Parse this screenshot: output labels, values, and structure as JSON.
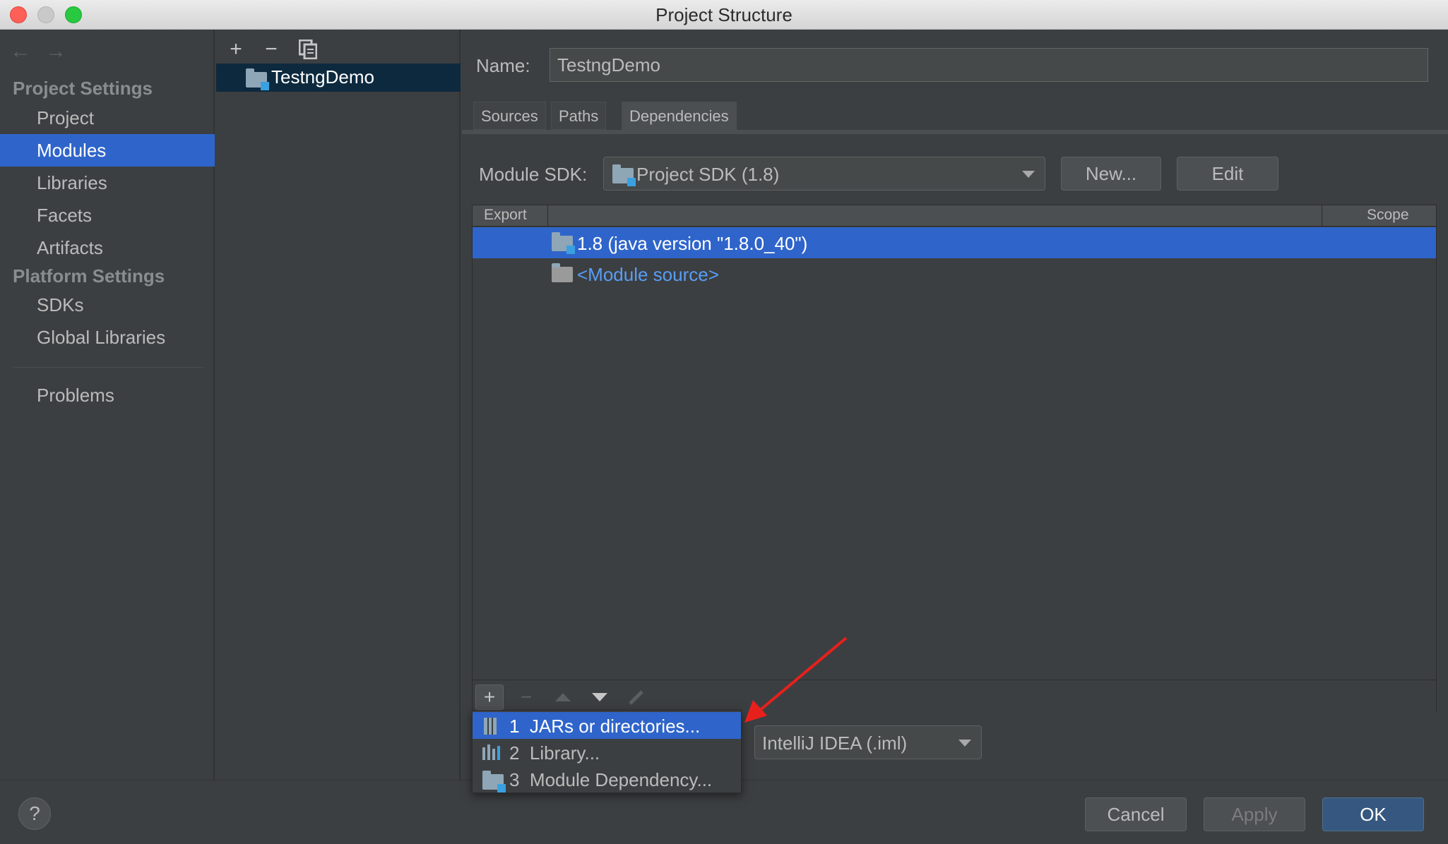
{
  "window": {
    "title": "Project Structure"
  },
  "sidebar": {
    "back_icon": "arrow-left-icon",
    "forward_icon": "arrow-right-icon",
    "sections": [
      {
        "heading": "Project Settings",
        "items": [
          "Project",
          "Modules",
          "Libraries",
          "Facets",
          "Artifacts"
        ]
      },
      {
        "heading": "Platform Settings",
        "items": [
          "SDKs",
          "Global Libraries"
        ]
      }
    ],
    "selected": "Modules",
    "problems": "Problems"
  },
  "module_panel": {
    "toolbar": {
      "add": "+",
      "remove": "−",
      "copy_icon": "copy-icon"
    },
    "modules": [
      "TestngDemo"
    ]
  },
  "module_details": {
    "name_label": "Name:",
    "name_value": "TestngDemo",
    "tabs": [
      "Sources",
      "Paths",
      "Dependencies"
    ],
    "active_tab": "Dependencies",
    "sdk_label": "Module SDK:",
    "sdk_value": "Project SDK (1.8)",
    "new_button": "New...",
    "edit_button": "Edit",
    "table": {
      "columns": [
        "Export",
        "Scope"
      ],
      "rows": [
        {
          "text": "1.8 (java version \"1.8.0_40\")",
          "icon": "jdk-folder-icon",
          "selected": true
        },
        {
          "text": "<Module source>",
          "icon": "folder-icon",
          "selected": false
        }
      ]
    },
    "table_toolbar": [
      "add-icon",
      "remove-icon",
      "move-up-icon",
      "move-down-icon",
      "edit-icon"
    ],
    "storage_format": "IntelliJ IDEA (.iml)"
  },
  "add_menu": {
    "items": [
      {
        "number": "1",
        "label": "JARs or directories...",
        "icon": "jar-icon",
        "selected": true
      },
      {
        "number": "2",
        "label": "Library...",
        "icon": "library-icon",
        "selected": false
      },
      {
        "number": "3",
        "label": "Module Dependency...",
        "icon": "module-icon",
        "selected": false
      }
    ]
  },
  "footer": {
    "help": "?",
    "cancel": "Cancel",
    "apply": "Apply",
    "ok": "OK"
  },
  "colors": {
    "background": "#3c3f41",
    "selection": "#2f65ca",
    "link": "#589df6",
    "annotation_arrow": "#e8201c"
  }
}
